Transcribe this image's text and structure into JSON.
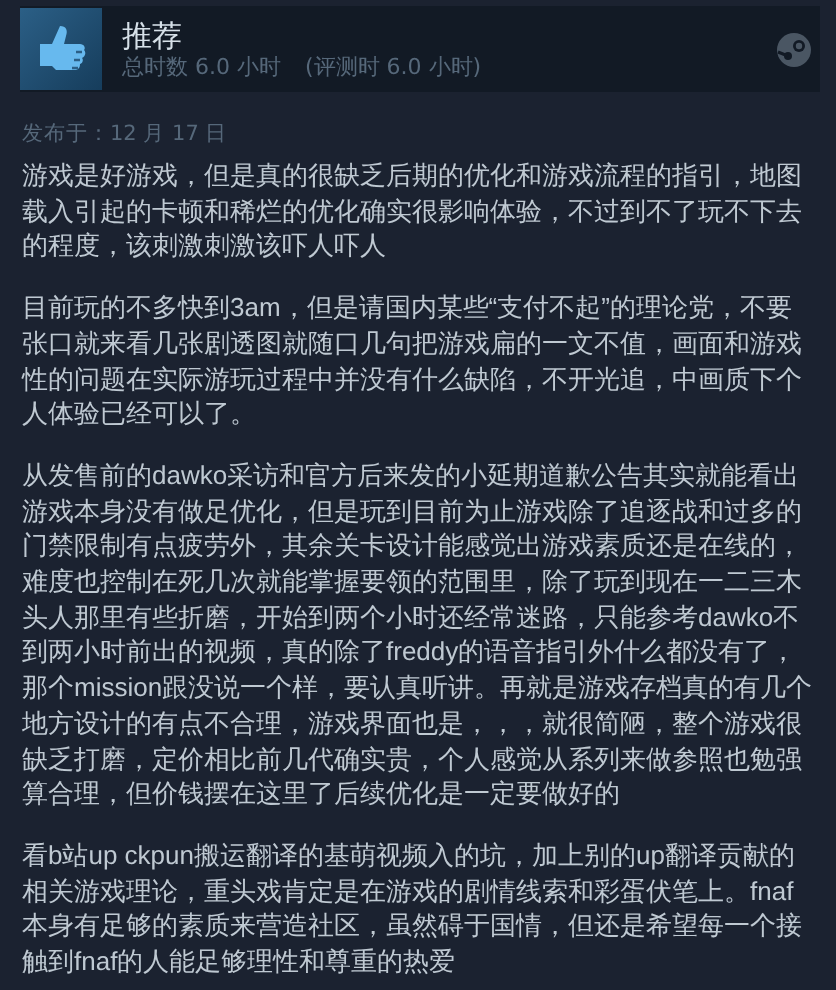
{
  "review": {
    "verdict": "推荐",
    "playtime": "总时数 6.0 小时",
    "playtime_at_review": "(评测时 6.0 小时)",
    "recommended": true
  },
  "posted": "发布于：12 月 17 日",
  "paragraphs": [
    "游戏是好游戏，但是真的很缺乏后期的优化和游戏流程的指引，地图载入引起的卡顿和稀烂的优化确实很影响体验，不过到不了玩不下去的程度，该刺激刺激该吓人吓人",
    "目前玩的不多快到3am，但是请国内某些“支付不起”的理论党，不要张口就来看几张剧透图就随口几句把游戏扁的一文不值，画面和游戏性的问题在实际游玩过程中并没有什么缺陷，不开光追，中画质下个人体验已经可以了。",
    "从发售前的dawko采访和官方后来发的小延期道歉公告其实就能看出游戏本身没有做足优化，但是玩到目前为止游戏除了追逐战和过多的门禁限制有点疲劳外，其余关卡设计能感觉出游戏素质还是在线的，难度也控制在死几次就能掌握要领的范围里，除了玩到现在一二三木头人那里有些折磨，开始到两个小时还经常迷路，只能参考dawko不到两小时前出的视频，真的除了freddy的语音指引外什么都没有了，那个mission跟没说一个样，要认真听讲。再就是游戏存档真的有几个地方设计的有点不合理，游戏界面也是，，，就很简陋，整个游戏很缺乏打磨，定价相比前几代确实贵，个人感觉从系列来做参照也勉强算合理，但价钱摆在这里了后续优化是一定要做好的",
    "看b站up ckpun搬运翻译的基萌视频入的坑，加上别的up翻译贡献的相关游戏理论，重头戏肯定是在游戏的剧情线索和彩蛋伏笔上。fnaf本身有足够的素质来营造社区，虽然碍于国情，但还是希望每一个接触到fnaf的人能足够理性和尊重的热爱"
  ]
}
